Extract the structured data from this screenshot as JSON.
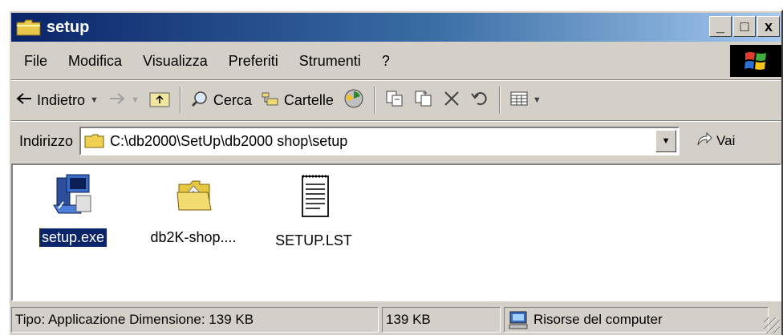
{
  "window": {
    "title": "setup",
    "minimize": "_",
    "maximize": "□",
    "close": "x"
  },
  "menu": [
    "File",
    "Modifica",
    "Visualizza",
    "Preferiti",
    "Strumenti",
    "?"
  ],
  "toolbar": {
    "back": "Indietro",
    "search": "Cerca",
    "folders": "Cartelle"
  },
  "address": {
    "label": "Indirizzo",
    "path": "C:\\db2000\\SetUp\\db2000 shop\\setup",
    "go": "Vai"
  },
  "files": [
    {
      "name": "setup.exe",
      "icon": "setup-program-icon",
      "selected": true
    },
    {
      "name": "db2K-shop....",
      "icon": "folder-icon",
      "selected": false
    },
    {
      "name": "SETUP.LST",
      "icon": "text-document-icon",
      "selected": false
    }
  ],
  "status": {
    "info": "Tipo: Applicazione Dimensione: 139 KB",
    "size": "139 KB",
    "location": "Risorse del computer"
  },
  "colors": {
    "title_start": "#0a246a",
    "title_end": "#a6caf0",
    "face": "#d4d0c8",
    "selection": "#0a246a"
  }
}
